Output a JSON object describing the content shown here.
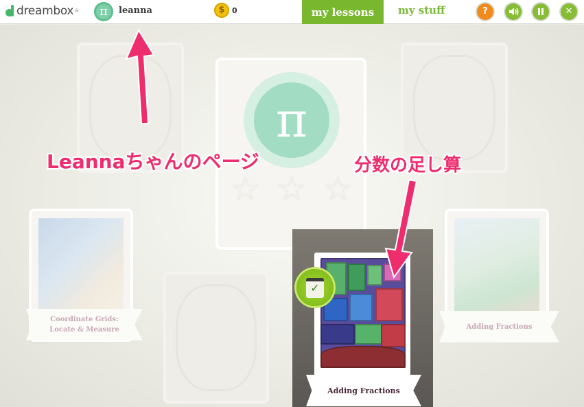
{
  "header": {
    "brand": "dreambox",
    "brand_tm": "®",
    "avatar_symbol": "π",
    "username": "leanna",
    "coin_symbol": "$",
    "coins": "0",
    "nav": {
      "lessons": "my lessons",
      "stuff": "my stuff"
    },
    "buttons": {
      "help": "?",
      "sound": "🔊",
      "pause": "❚❚",
      "close": "✕"
    }
  },
  "board": {
    "center_badge_symbol": "π",
    "stars": [
      "☆",
      "☆",
      "☆"
    ],
    "lessons": [
      {
        "title_line1": "Coordinate Grids:",
        "title_line2": "Locate & Measure"
      },
      {
        "title": "Adding Fractions",
        "active": true
      },
      {
        "title": "Adding Fractions"
      }
    ]
  },
  "annotations": {
    "user_page": "Leannaちゃんのページ",
    "fraction_add": "分数の足し算"
  },
  "colors": {
    "brand_green": "#45b86a",
    "nav_active": "#79b72e",
    "help_orange": "#f08a1c",
    "annotation_pink": "#ee2d6e"
  }
}
